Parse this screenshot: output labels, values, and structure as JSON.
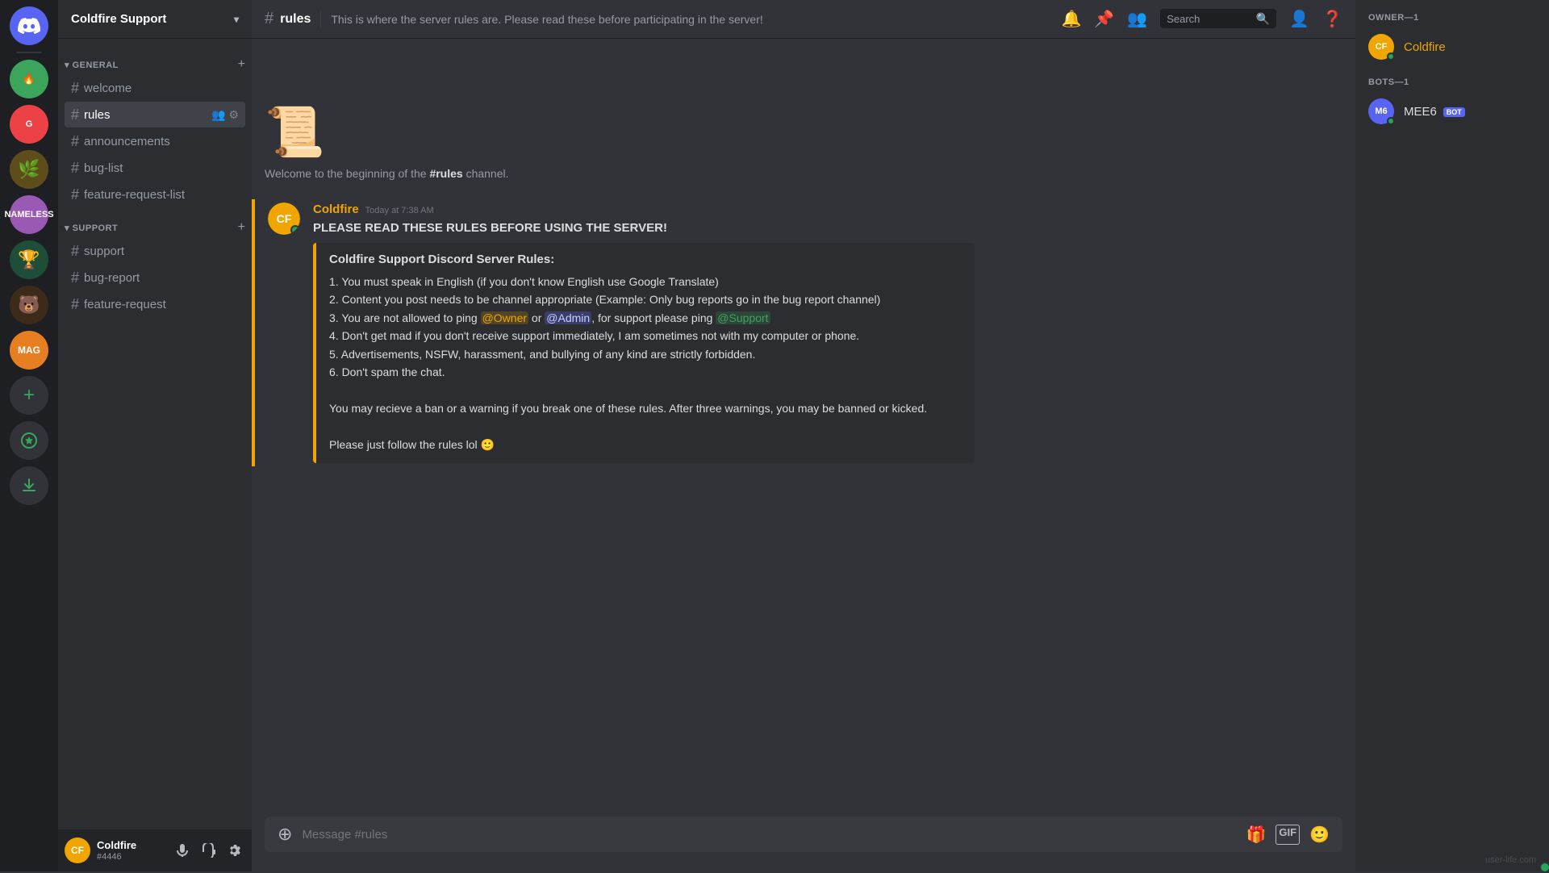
{
  "app": {
    "watermark": "user-life.com"
  },
  "serverList": {
    "items": [
      {
        "id": "home",
        "label": "DC",
        "colorClass": "sv1"
      },
      {
        "id": "s1",
        "label": "CF",
        "colorClass": "sv2"
      },
      {
        "id": "s2",
        "label": "G",
        "colorClass": "sv3"
      },
      {
        "id": "s3",
        "label": "",
        "colorClass": "sv4"
      },
      {
        "id": "s4",
        "label": "N",
        "colorClass": "sv5"
      },
      {
        "id": "s5",
        "label": "",
        "colorClass": "sv6"
      },
      {
        "id": "s6",
        "label": "M",
        "colorClass": "sv7"
      }
    ],
    "addLabel": "+",
    "exploreLabel": "🔍",
    "downloadLabel": "⬇"
  },
  "channelSidebar": {
    "serverName": "Coldfire Support",
    "categories": [
      {
        "name": "GENERAL",
        "channels": [
          {
            "name": "welcome",
            "active": false
          },
          {
            "name": "rules",
            "active": true
          },
          {
            "name": "announcements",
            "active": false
          },
          {
            "name": "bug-list",
            "active": false
          },
          {
            "name": "feature-request-list",
            "active": false
          }
        ]
      },
      {
        "name": "SUPPORT",
        "channels": [
          {
            "name": "support",
            "active": false
          },
          {
            "name": "bug-report",
            "active": false
          },
          {
            "name": "feature-request",
            "active": false
          }
        ]
      }
    ]
  },
  "userPanel": {
    "name": "Coldfire",
    "tag": "#4446",
    "avatarColor": "#f0a500"
  },
  "channelHeader": {
    "name": "rules",
    "topic": "This is where the server rules are. Please read these before participating in the server!",
    "searchPlaceholder": "Search"
  },
  "messages": {
    "channelBeginning": "Welcome to the beginning of the #rules channel.",
    "channelBeginningHashName": "#rules",
    "messageGroup": {
      "author": "Coldfire",
      "timestamp": "Today at 7:38 AM",
      "mainText": "PLEASE READ THESE RULES BEFORE USING THE SERVER!",
      "embed": {
        "title": "Coldfire Support Discord Server Rules:",
        "rules": [
          "1. You must speak in English (if you don't know English use Google Translate)",
          "2. Content you post needs to be channel appropriate (Example: Only bug reports go in the bug report channel)",
          "3. You are not allowed to ping @Owner or @Admin, for support please ping @Support",
          "4. Don't get mad if you don't receive support immediately, I am sometimes not with my computer or phone.",
          "5. Advertisements, NSFW, harassment, and bullying of any kind are strictly forbidden.",
          "6. Don't spam the chat."
        ],
        "rule3Parts": {
          "before": "3. You are not allowed to ping ",
          "mention1": "@Owner",
          "between": " or ",
          "mention2": "@Admin",
          "after": ", for support please ping ",
          "mention3": "@Support"
        },
        "warning": "You may recieve a ban or a warning if you break one of these rules. After three warnings, you may be banned or kicked.",
        "footer": "Please just follow the rules lol 🙂"
      }
    }
  },
  "messageInput": {
    "placeholder": "Message #rules"
  },
  "membersSidebar": {
    "sections": [
      {
        "title": "OWNER—1",
        "members": [
          {
            "name": "Coldfire",
            "colorClass": "sv4",
            "online": true,
            "isBot": false
          }
        ]
      },
      {
        "title": "BOTS—1",
        "members": [
          {
            "name": "MEE6",
            "colorClass": "sv1",
            "online": true,
            "isBot": true
          }
        ]
      }
    ]
  }
}
